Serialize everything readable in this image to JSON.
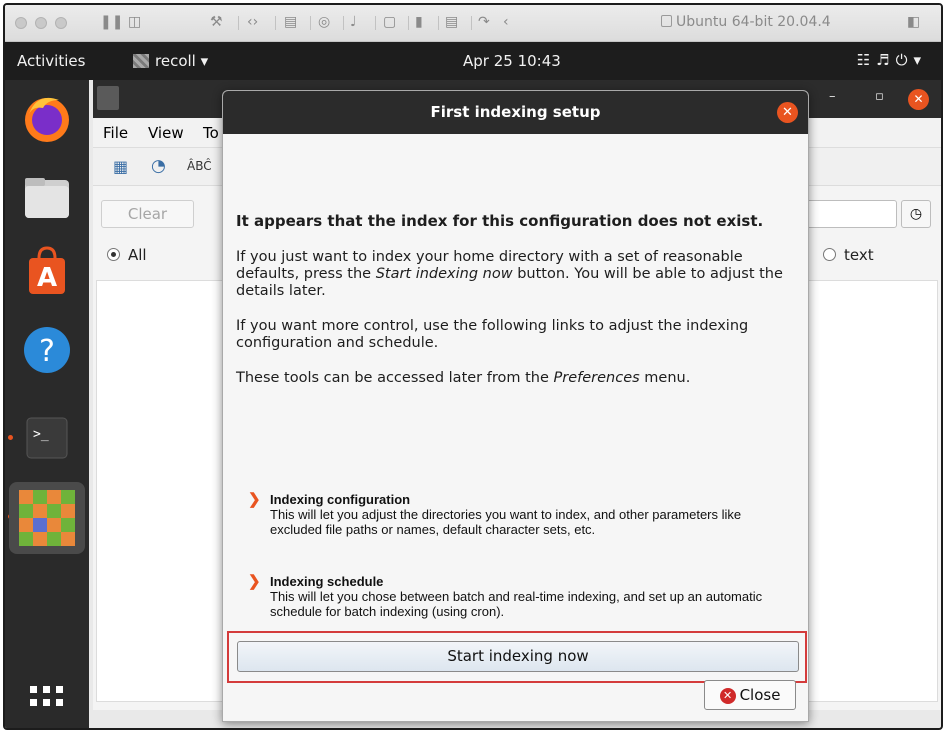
{
  "vm": {
    "title": "Ubuntu 64-bit 20.04.4"
  },
  "topbar": {
    "activities": "Activities",
    "app_name": "recoll ▾",
    "clock": "Apr 25  10:43"
  },
  "recoll": {
    "menu": [
      "File",
      "View",
      "To"
    ],
    "clear_label": "Clear",
    "radio_all": "All",
    "radio_text": "text"
  },
  "dialog": {
    "title": "First indexing setup",
    "heading": "It appears that the index for this configuration does not exist.",
    "para1_a": "If you just want to index your home directory with a set of reasonable defaults, press the ",
    "para1_em": "Start indexing now",
    "para1_b": " button. You will be able to adjust the details later.",
    "para2": "If you want more control, use the following links to adjust the indexing configuration and schedule.",
    "para3_a": "These tools can be accessed later from the ",
    "para3_em": "Preferences",
    "para3_b": " menu.",
    "links": [
      {
        "title": "Indexing configuration",
        "desc": "This will let you adjust the directories you want to index, and other parameters like excluded file paths or names, default character sets, etc."
      },
      {
        "title": "Indexing schedule",
        "desc": "This will let you chose between batch and real-time indexing, and set up an automatic  schedule for batch indexing (using cron)."
      }
    ],
    "start_label": "Start indexing now",
    "close_label": "Close"
  },
  "colors": {
    "ubuntu_orange": "#e95420",
    "highlight_box": "#d43b3b"
  }
}
